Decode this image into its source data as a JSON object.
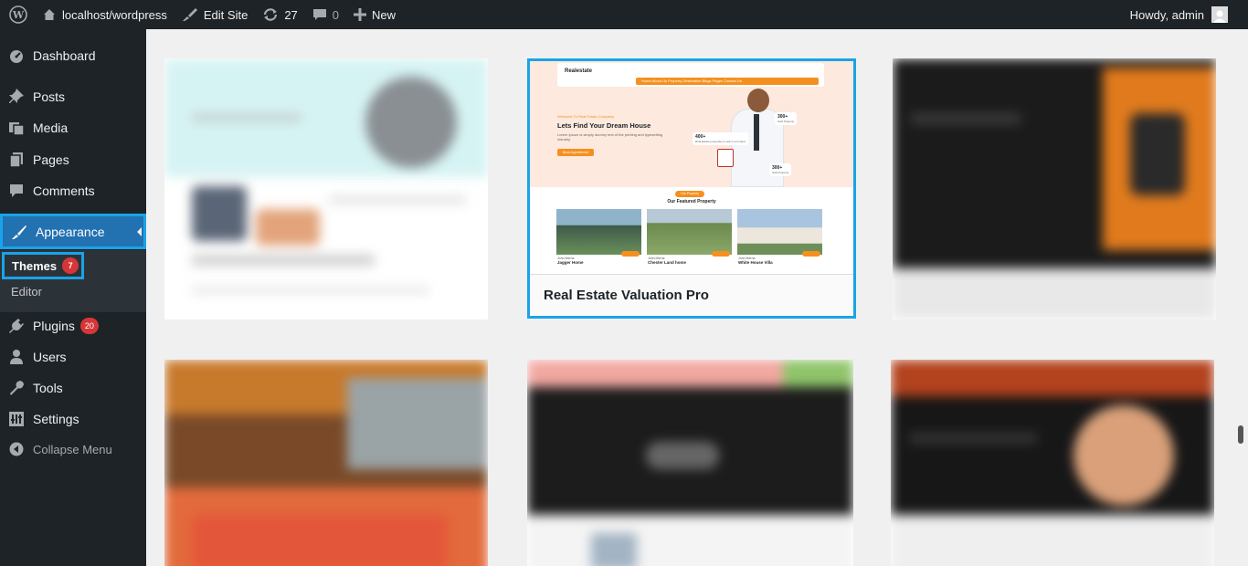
{
  "admin_bar": {
    "site_name": "localhost/wordpress",
    "edit_site": "Edit Site",
    "updates_count": "27",
    "comments_count": "0",
    "new_label": "New",
    "greeting": "Howdy, admin"
  },
  "sidebar": {
    "dashboard": "Dashboard",
    "posts": "Posts",
    "media": "Media",
    "pages": "Pages",
    "comments": "Comments",
    "appearance": "Appearance",
    "themes": "Themes",
    "themes_count": "7",
    "editor": "Editor",
    "plugins": "Plugins",
    "plugins_count": "20",
    "users": "Users",
    "tools": "Tools",
    "settings": "Settings",
    "collapse": "Collapse Menu"
  },
  "active_theme": {
    "name": "Real Estate Valuation Pro",
    "preview": {
      "logo": "Realestate",
      "nav": "Home   About Us   Property   Destination   Blogs   Pages   Contact Us",
      "kicker": "Welcome To Real Estate Company",
      "headline": "Lets Find Your Dream House",
      "text": "Lorem Ipsum is simply dummy text of the printing and typesetting industry.",
      "button": "Book Appointment",
      "stat1": "400+",
      "stat1_sub": "Real Estate properties to sell in our Hand",
      "stat2": "300+",
      "stat2_sub": "Sold Property",
      "stat3": "300+",
      "stat3_sub": "Sold Property",
      "pill": "Our Property",
      "section_title": "Our Featured Property",
      "cards": [
        {
          "agent": "John Merna",
          "title": "Jagger Home"
        },
        {
          "agent": "John Merna",
          "title": "Chester Land home"
        },
        {
          "agent": "John Merna",
          "title": "White House Villa"
        }
      ]
    }
  },
  "colors": {
    "admin_dark": "#1d2327",
    "accent_blue": "#2271b1",
    "highlight_border": "#1aa3e8",
    "badge_red": "#d63638",
    "brand_orange": "#f5901f"
  }
}
